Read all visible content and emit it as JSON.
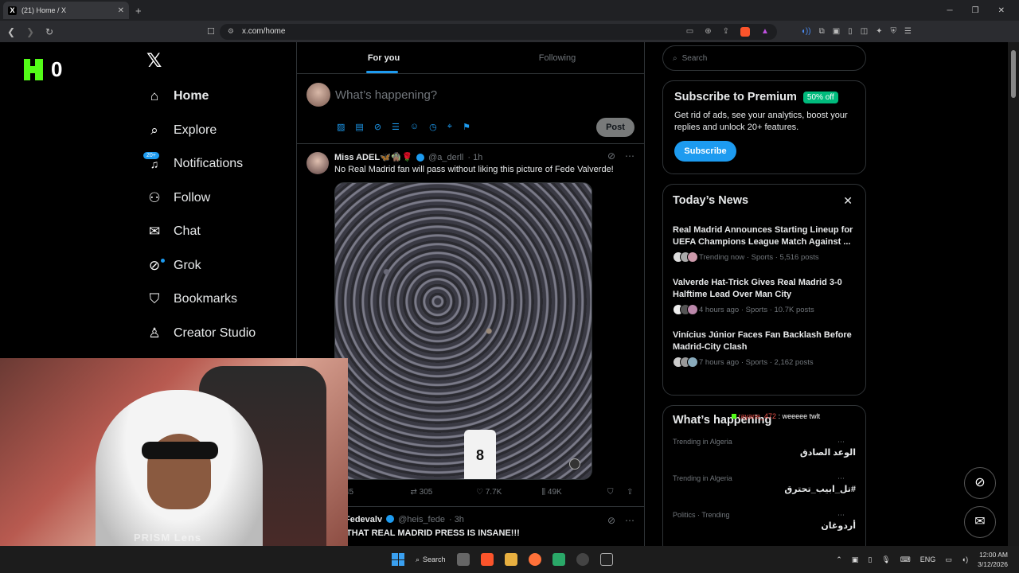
{
  "browser": {
    "tab_title": "(21) Home / X",
    "url": "x.com/home",
    "new_tab": "+",
    "tab_close": "✕"
  },
  "overlay": {
    "counter": "0"
  },
  "nav": {
    "items": [
      {
        "label": "Home",
        "icon": "⌂"
      },
      {
        "label": "Explore",
        "icon": "⌕"
      },
      {
        "label": "Notifications",
        "icon": "🔔",
        "badge": "20+"
      },
      {
        "label": "Follow",
        "icon": "⚇"
      },
      {
        "label": "Chat",
        "icon": "✉"
      },
      {
        "label": "Grok",
        "icon": "⊘"
      },
      {
        "label": "Bookmarks",
        "icon": "⛉"
      },
      {
        "label": "Creator Studio",
        "icon": "♙"
      }
    ]
  },
  "timeline": {
    "tabs": [
      "For you",
      "Following"
    ],
    "compose_placeholder": "What’s happening?",
    "post_label": "Post",
    "tweet1": {
      "name": "Miss ADEL🦋🧌🌹",
      "handle": "@a_derll",
      "time": "· 1h",
      "text": "No Real Madrid fan will pass without liking this picture of Fede Valverde!",
      "jersey": "8",
      "replies": "45",
      "retweets": "305",
      "likes": "7.7K",
      "views": "49K"
    },
    "tweet2": {
      "name": "Fedevalv",
      "handle": "@heis_fede",
      "time": "· 3h",
      "text": "THAT REAL MADRID PRESS IS INSANE!!!"
    }
  },
  "right": {
    "search_placeholder": "Search",
    "premium": {
      "title": "Subscribe to Premium",
      "badge": "50% off",
      "text": "Get rid of ads, see your analytics, boost your replies and unlock 20+ features.",
      "button": "Subscribe"
    },
    "news": {
      "title": "Today’s News",
      "items": [
        {
          "title": "Real Madrid Announces Starting Lineup for UEFA Champions League Match Against ...",
          "meta": "Trending now · Sports · 5,516 posts"
        },
        {
          "title": "Valverde Hat-Trick Gives Real Madrid 3-0 Halftime Lead Over Man City",
          "meta": "4 hours ago · Sports · 10.7K posts"
        },
        {
          "title": "Vinícius Júnior Faces Fan Backlash Before Madrid-City Clash",
          "meta": "7 hours ago · Sports · 2,162 posts"
        }
      ]
    },
    "happening": {
      "title": "What’s happening",
      "chat_user": "rayane_472",
      "chat_text": ": weeeee twlt",
      "trends": [
        {
          "label": "Trending in Algeria",
          "title": "الوعد الصادق"
        },
        {
          "label": "Trending in Algeria",
          "title": "#تل_ابيب_تحترق"
        },
        {
          "label": "Politics · Trending",
          "title": "أردوغان"
        }
      ]
    }
  },
  "cam": {
    "watermark": "PRISM Lens"
  },
  "taskbar": {
    "search": "Search",
    "lang": "ENG",
    "time": "12:00 AM",
    "date": "3/12/2026"
  },
  "colors": {
    "accent": "#1d9bf0",
    "kick": "#53fc18",
    "premium_badge": "#00ba7c"
  }
}
